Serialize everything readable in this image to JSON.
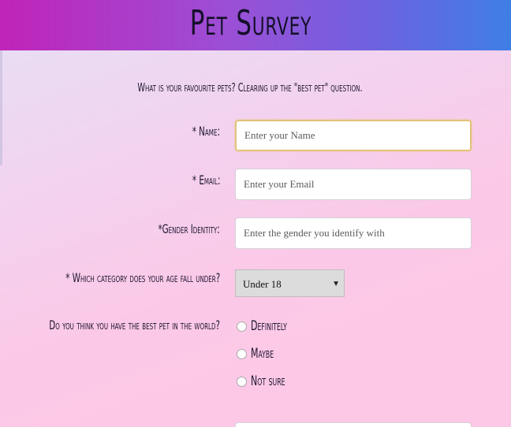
{
  "header": {
    "title": "Pet Survey"
  },
  "form": {
    "description": "What is your favourite pets? Clearing up the \"best pet\" question.",
    "name": {
      "label": "* Name:",
      "placeholder": "Enter your Name",
      "value": ""
    },
    "email": {
      "label": "* Email:",
      "placeholder": "Enter your Email",
      "value": ""
    },
    "gender": {
      "label": "*Gender Identity:",
      "placeholder": "Enter the gender you identify with",
      "value": ""
    },
    "age": {
      "label": "* Which category does your age fall under?",
      "selected": "Under 18"
    },
    "best_pet": {
      "label": "Do you think you have the best pet in the world?",
      "options": [
        "Definitely",
        "Maybe",
        "Not sure"
      ]
    }
  },
  "colors": {
    "header_gradient_start": "#c024b8",
    "header_gradient_end": "#3f7fe6",
    "focus_border": "#e3c27a"
  }
}
